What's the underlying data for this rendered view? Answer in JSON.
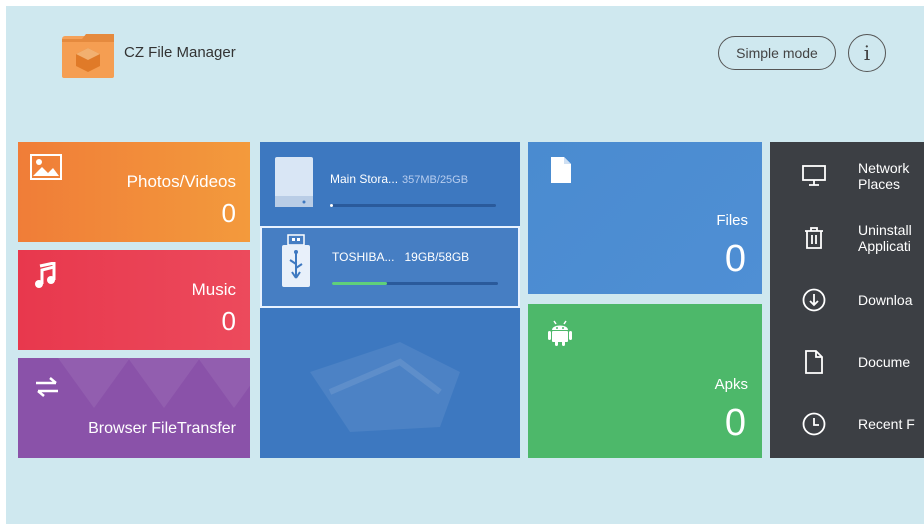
{
  "header": {
    "title": "CZ File Manager",
    "simple_mode_label": "Simple mode",
    "info_label": "i"
  },
  "tiles": {
    "photos": {
      "label": "Photos/Videos",
      "count": "0",
      "icon": "image-icon"
    },
    "music": {
      "label": "Music",
      "count": "0",
      "icon": "music-note-icon"
    },
    "transfer": {
      "label": "Browser FileTransfer",
      "icon": "swap-arrows-icon"
    },
    "files": {
      "label": "Files",
      "count": "0",
      "icon": "document-icon"
    },
    "apks": {
      "label": "Apks",
      "count": "0",
      "icon": "android-icon"
    }
  },
  "storage": [
    {
      "name": "Main Stora...",
      "size": "357MB/25GB",
      "progress": 0.014,
      "icon": "internal-storage-icon"
    },
    {
      "name": "TOSHIBA...",
      "size": "19GB/58GB",
      "progress": 0.33,
      "icon": "usb-icon"
    }
  ],
  "menu": [
    {
      "label": "Network\nPlaces",
      "icon": "monitor-icon"
    },
    {
      "label": "Uninstall\nApplicati",
      "icon": "trash-icon"
    },
    {
      "label": "Downloa",
      "icon": "download-icon"
    },
    {
      "label": "Docume",
      "icon": "file-icon"
    },
    {
      "label": "Recent F",
      "icon": "clock-icon"
    }
  ],
  "colors": {
    "background": "#cfe8ef",
    "photos": "#f07d38",
    "music": "#e8384d",
    "transfer": "#8a52a9",
    "storage": "#3d78c0",
    "files": "#4a8bd0",
    "apks": "#4db86a",
    "menu": "#3c3f44",
    "usb_progress": "#5fd07a"
  }
}
